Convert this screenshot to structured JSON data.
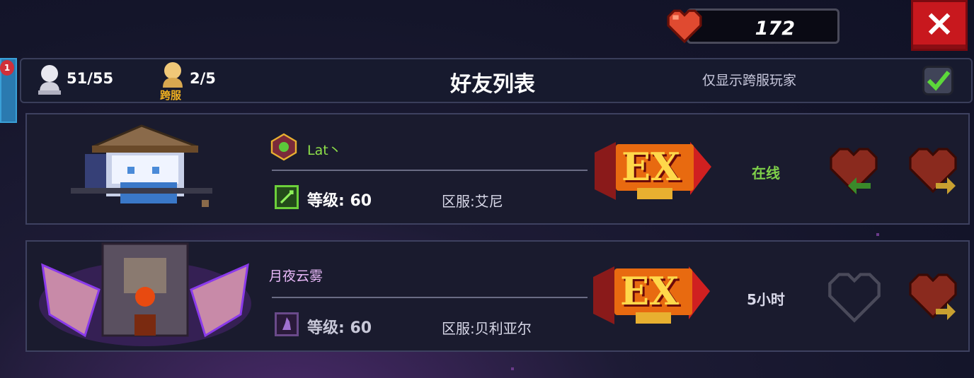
{
  "hearts": {
    "count": "172"
  },
  "close_label": "×",
  "notification_count": "1",
  "header": {
    "friends_count": "51/55",
    "cross_server_count": "2/5",
    "cross_server_label": "跨服",
    "title": "好友列表",
    "filter_label": "仅显示跨服玩家",
    "filter_checked": true
  },
  "friends": [
    {
      "name": "Lat丶",
      "level_label": "等级: 60",
      "server_label": "区服:艾尼",
      "badge": "EX",
      "status": "在线",
      "status_color": "#7fd04a",
      "name_color": "#8ee04a",
      "heart_gift_state": "filled",
      "heart_send_state": "filled"
    },
    {
      "name": "月夜云雾",
      "level_label": "等级: 60",
      "server_label": "区服:贝利亚尔",
      "badge": "EX",
      "status": "5小时",
      "status_color": "#d8d8e8",
      "name_color": "#e8b8f8",
      "heart_gift_state": "empty",
      "heart_send_state": "filled"
    }
  ],
  "colors": {
    "heart_red": "#d8442c",
    "close_red": "#c8181e",
    "accent_green": "#6cd03a",
    "panel_bg": "#1a1b2e"
  }
}
